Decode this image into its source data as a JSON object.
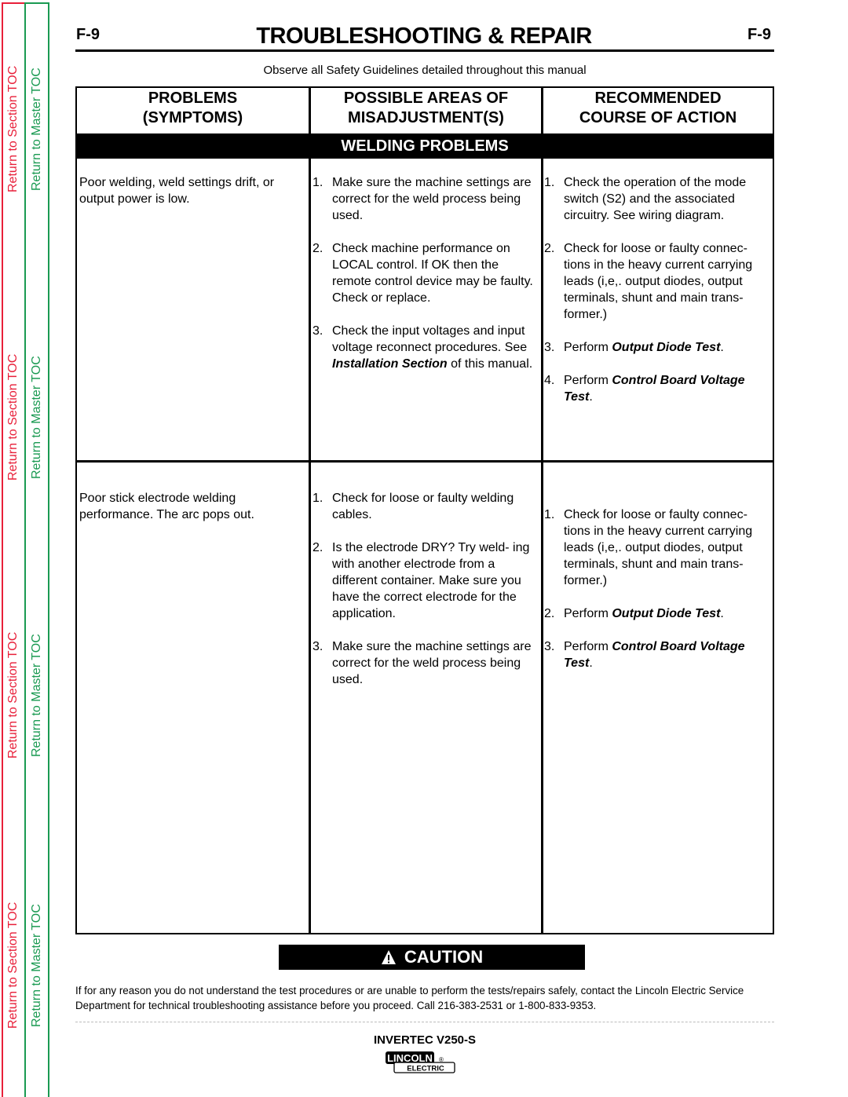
{
  "nav": {
    "section_toc_label": "Return to Section TOC",
    "master_toc_label": "Return to Master TOC",
    "colors": {
      "section": "#e8203a",
      "master": "#1a9a52"
    }
  },
  "header": {
    "page_number": "F-9",
    "title": "TROUBLESHOOTING & REPAIR",
    "safety_note": "Observe all Safety Guidelines detailed throughout this manual"
  },
  "table": {
    "columns": [
      {
        "line1": "PROBLEMS",
        "line2": "(SYMPTOMS)"
      },
      {
        "line1": "POSSIBLE AREAS OF",
        "line2": "MISADJUSTMENT(S)"
      },
      {
        "line1": "RECOMMENDED",
        "line2": "COURSE OF ACTION"
      }
    ],
    "section_band": "WELDING  PROBLEMS",
    "rows": [
      {
        "symptom": "Poor welding, weld settings drift, or output power is low.",
        "areas": [
          {
            "num": "1.",
            "text": "Make sure the machine settings are correct for the weld process being used."
          },
          {
            "num": "2.",
            "text": "Check machine performance on LOCAL control.  If OK then the remote control device may be faulty.  Check or replace."
          },
          {
            "num": "3.",
            "pre": "Check the input voltages and input voltage reconnect procedures.  See ",
            "emph": "Installation Section",
            "post": " of this manual."
          }
        ],
        "actions": [
          {
            "num": "1.",
            "text": "Check the operation of the mode switch (S2) and the associated circuitry.  See wiring diagram."
          },
          {
            "num": "2.",
            "text": "Check for loose or faulty connec- tions in the heavy current carrying leads (i,e,. output diodes, output terminals, shunt and main trans- former.)"
          },
          {
            "num": "3.",
            "pre": "Perform ",
            "emph": "Output Diode Test",
            "post": "."
          },
          {
            "num": "4.",
            "pre": "Perform ",
            "emph": "Control Board Voltage Test",
            "post": "."
          }
        ]
      },
      {
        "symptom": "Poor stick electrode welding performance.  The arc pops out.",
        "areas": [
          {
            "num": "1.",
            "text": "Check for loose or faulty welding cables."
          },
          {
            "num": "2.",
            "text": "Is the electrode DRY?  Try weld- ing with another electrode from a different container.  Make sure you have the correct electrode for the application."
          },
          {
            "num": "3.",
            "text": "Make sure the machine settings are correct for the weld process being used."
          }
        ],
        "actions": [
          {
            "num": "1.",
            "text": "Check for loose or faulty connec- tions in the heavy current carrying leads (i,e,. output diodes, output terminals, shunt and main trans- former.)"
          },
          {
            "num": "2.",
            "pre": "Perform ",
            "emph": "Output Diode Test",
            "post": "."
          },
          {
            "num": "3.",
            "pre": "Perform ",
            "emph": "Control Board Voltage Test",
            "post": "."
          }
        ]
      }
    ]
  },
  "caution": {
    "icon": "warning-triangle-icon",
    "label": "CAUTION",
    "text": "If for any reason you do not understand the test procedures or are unable to perform the tests/repairs safely, contact the Lincoln Electric Service Department for technical troubleshooting assistance before you proceed. Call 216-383-2531 or 1-800-833-9353."
  },
  "footer": {
    "model": "INVERTEC V250-S",
    "logo_top": "LINCOLN",
    "logo_bottom": "ELECTRIC",
    "logo_mark": "®"
  }
}
